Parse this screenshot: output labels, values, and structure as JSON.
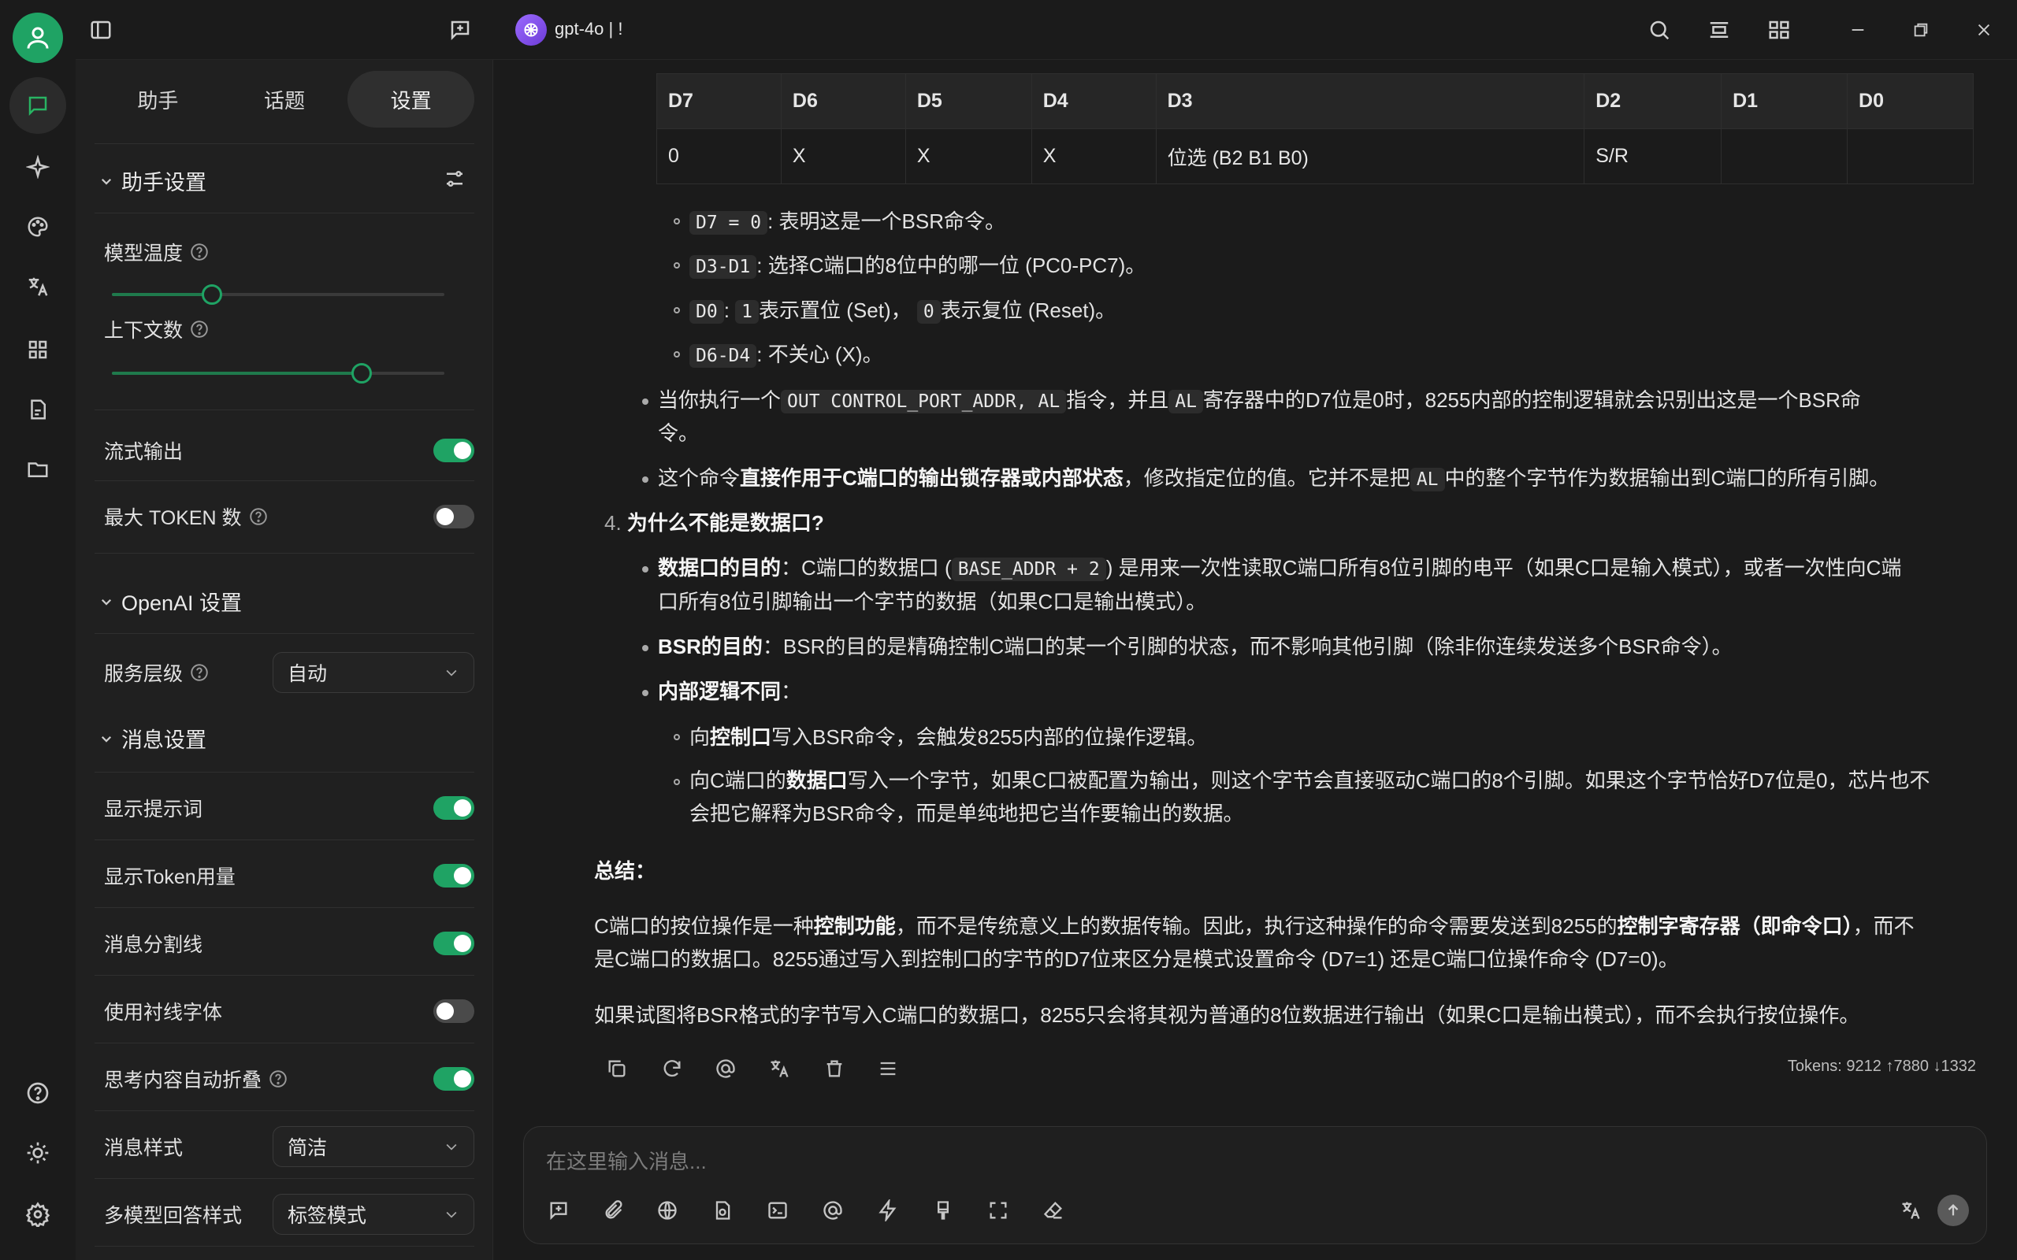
{
  "titlebar": {
    "model_name": "gpt-4o | !"
  },
  "rail": {
    "icons": [
      "avatar-icon",
      "chat-icon",
      "sparkle-icon",
      "palette-icon",
      "translate-icon",
      "apps-icon",
      "document-icon",
      "folder-icon",
      "help-icon",
      "theme-icon",
      "settings-icon"
    ]
  },
  "panel": {
    "tabs": [
      "助手",
      "话题",
      "设置"
    ],
    "assistant_section": "助手设置",
    "temperature_label": "模型温度",
    "temperature_level": 0.3,
    "context_label": "上下文数",
    "context_level": 0.75,
    "stream_label": "流式输出",
    "max_token_label": "最大 TOKEN 数",
    "openai_section": "OpenAI 设置",
    "service_tier_label": "服务层级",
    "service_tier_value": "自动",
    "message_section": "消息设置",
    "show_prompt_label": "显示提示词",
    "show_token_label": "显示Token用量",
    "divider_label": "消息分割线",
    "serif_label": "使用衬线字体",
    "think_fold_label": "思考内容自动折叠",
    "msg_style_label": "消息样式",
    "msg_style_value": "简洁",
    "multi_model_label": "多模型回答样式",
    "multi_model_value": "标签模式"
  },
  "table": {
    "headers": [
      "D7",
      "D6",
      "D5",
      "D4",
      "D3",
      "D2",
      "D1",
      "D0"
    ],
    "row": [
      "0",
      "X",
      "X",
      "X",
      "位选 (B2 B1 B0)",
      "S/R",
      "",
      ""
    ]
  },
  "message": {
    "b1_code": "D7 = 0",
    "b1_text": ": 表明这是一个BSR命令。",
    "b2_code": "D3-D1",
    "b2_text": ": 选择C端口的8位中的哪一位 (PC0-PC7)。",
    "b3_code": "D0",
    "b3_sep": ":",
    "b3_code2": "1",
    "b3_text": "表示置位 (Set)，",
    "b3_code3": "0",
    "b3_text2": "表示复位 (Reset)。",
    "b4_code": "D6-D4",
    "b4_text": ": 不关心 (X)。",
    "p1_a": "当你执行一个",
    "p1_code": "OUT CONTROL_PORT_ADDR, AL",
    "p1_b": "指令，并且",
    "p1_code2": "AL",
    "p1_c": "寄存器中的D7位是0时，8255内部的控制逻辑就会识别出这是一个BSR命",
    "p1_d": "令。",
    "p2_a": "这个命令",
    "p2_b": "直接作用于C端口的输出锁存器或内部状态",
    "p2_c": "，修改指定位的值。它并不是把",
    "p2_code": "AL",
    "p2_d": "中的整个字节作为数据输出到C端口的所有引脚。",
    "h4_num": "4.",
    "h4": "为什么不能是数据口?",
    "d1_a": "数据口的目的",
    "d1_b": "：C端口的数据口 (",
    "d1_code": "BASE_ADDR + 2",
    "d1_c": ") 是用来一次性读取C端口所有8位引脚的电平（如果C口是输入模式），或者一次性向C端",
    "d1_d": "口所有8位引脚输出一个字节的数据（如果C口是输出模式）。",
    "d2_a": "BSR的目的",
    "d2_b": "：BSR的目的是精确控制C端口的某一个引脚的状态，而不影响其他引脚（除非你连续发送多个BSR命令）。",
    "d3_a": "内部逻辑不同",
    "d3_b": "：",
    "s1_a": "向",
    "s1_b": "控制口",
    "s1_c": "写入BSR命令，会触发8255内部的位操作逻辑。",
    "s2_a": "向C端口的",
    "s2_b": "数据口",
    "s2_c": "写入一个字节，如果C口被配置为输出，则这个字节会直接驱动C端口的8个引脚。如果这个字节恰好D7位是0，芯片也不",
    "s2_d": "会把它解释为BSR命令，而是单纯地把它当作要输出的数据。",
    "summary_title": "总结：",
    "sum1_a": "C端口的按位操作是一种",
    "sum1_b": "控制功能",
    "sum1_c": "，而不是传统意义上的数据传输。因此，执行这种操作的命令需要发送到8255的",
    "sum1_d": "控制字寄存器（即命令口）",
    "sum1_e": "，而不",
    "sum1_f": "是C端口的数据口。8255通过写入到控制口的字节的D7位来区分是模式设置命令 (D7=1) 还是C端口位操作命令 (D7=0)。",
    "sum2": "如果试图将BSR格式的字节写入C端口的数据口，8255只会将其视为普通的8位数据进行输出（如果C口是输出模式），而不会执行按位操作。",
    "tokens": "Tokens: 9212 ↑7880 ↓1332"
  },
  "input": {
    "placeholder": "在这里输入消息..."
  }
}
